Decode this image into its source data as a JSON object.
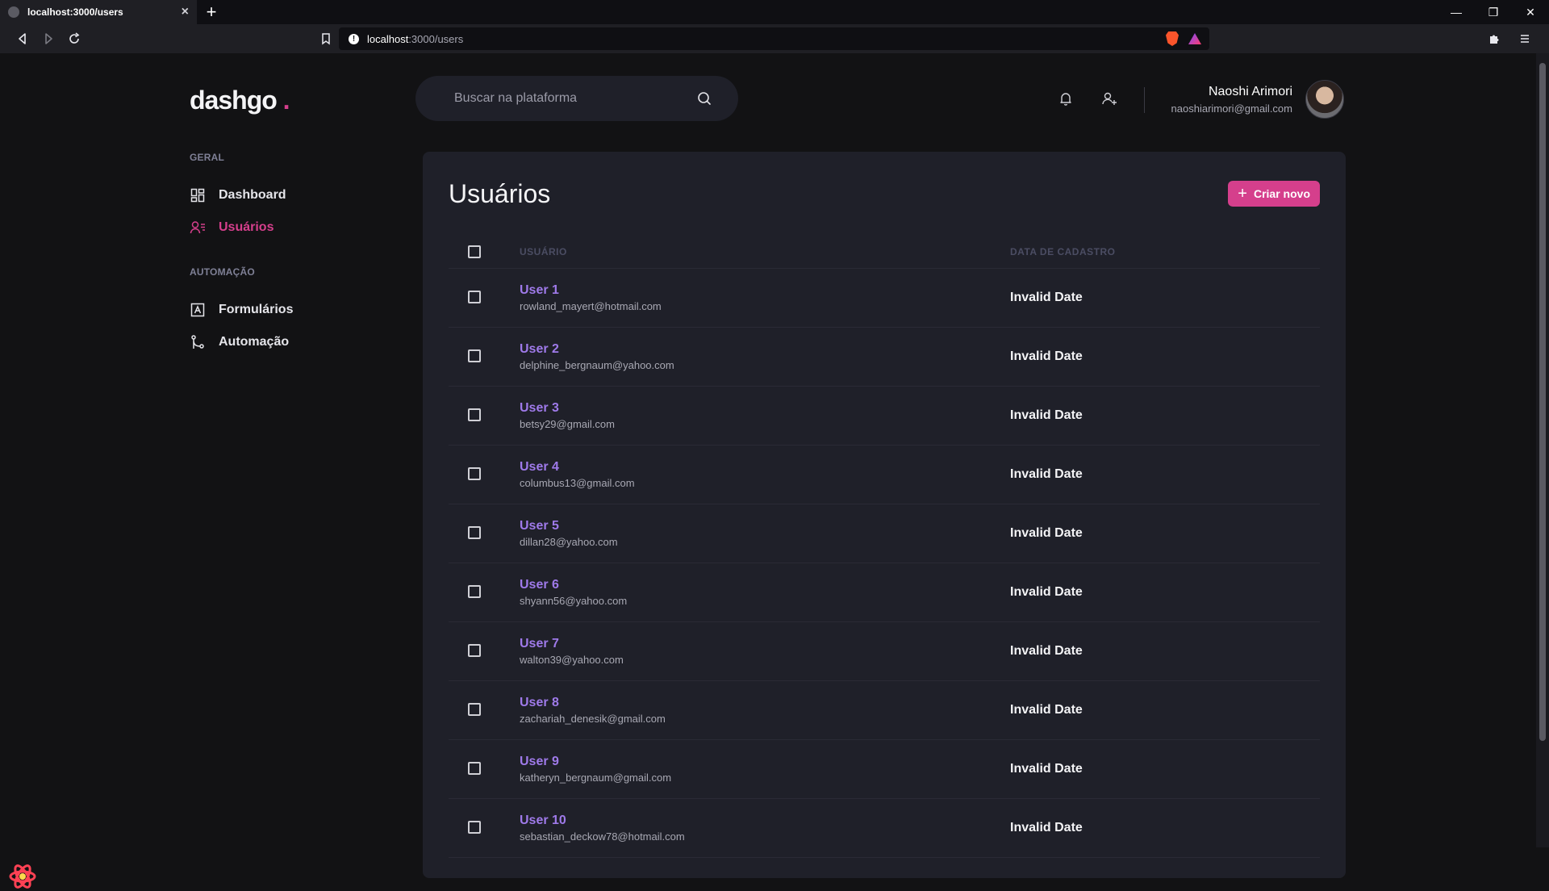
{
  "browser": {
    "tab_title": "localhost:3000/users",
    "url_host": "localhost",
    "url_path": ":3000/users"
  },
  "app": {
    "logo": "dashgo",
    "logo_dot": "."
  },
  "search": {
    "placeholder": "Buscar na plataforma"
  },
  "profile": {
    "name": "Naoshi Arimori",
    "email": "naoshiarimori@gmail.com"
  },
  "sidebar": {
    "sections": [
      {
        "title": "GERAL",
        "items": [
          {
            "label": "Dashboard",
            "icon": "dashboard-icon",
            "active": false
          },
          {
            "label": "Usuários",
            "icon": "users-icon",
            "active": true
          }
        ]
      },
      {
        "title": "AUTOMAÇÃO",
        "items": [
          {
            "label": "Formulários",
            "icon": "form-icon",
            "active": false
          },
          {
            "label": "Automação",
            "icon": "git-merge-icon",
            "active": false
          }
        ]
      }
    ]
  },
  "main": {
    "title": "Usuários",
    "create_button": "Criar novo",
    "columns": {
      "user": "USUÁRIO",
      "date": "DATA DE CADASTRO"
    },
    "rows": [
      {
        "name": "User 1",
        "email": "rowland_mayert@hotmail.com",
        "date": "Invalid Date"
      },
      {
        "name": "User 2",
        "email": "delphine_bergnaum@yahoo.com",
        "date": "Invalid Date"
      },
      {
        "name": "User 3",
        "email": "betsy29@gmail.com",
        "date": "Invalid Date"
      },
      {
        "name": "User 4",
        "email": "columbus13@gmail.com",
        "date": "Invalid Date"
      },
      {
        "name": "User 5",
        "email": "dillan28@yahoo.com",
        "date": "Invalid Date"
      },
      {
        "name": "User 6",
        "email": "shyann56@yahoo.com",
        "date": "Invalid Date"
      },
      {
        "name": "User 7",
        "email": "walton39@yahoo.com",
        "date": "Invalid Date"
      },
      {
        "name": "User 8",
        "email": "zachariah_denesik@gmail.com",
        "date": "Invalid Date"
      },
      {
        "name": "User 9",
        "email": "katheryn_bergnaum@gmail.com",
        "date": "Invalid Date"
      },
      {
        "name": "User 10",
        "email": "sebastian_deckow78@hotmail.com",
        "date": "Invalid Date"
      }
    ]
  },
  "colors": {
    "accent": "#d53f8c",
    "link": "#9f7aea",
    "background": "#121214",
    "card": "#1f2029"
  }
}
